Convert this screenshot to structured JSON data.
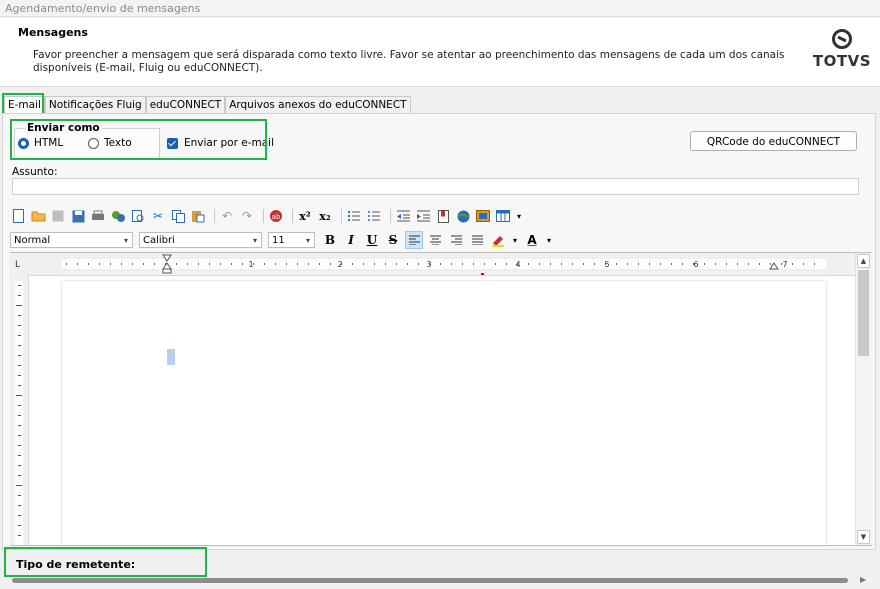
{
  "window": {
    "title": "Agendamento/envio de mensagens"
  },
  "header": {
    "title": "Mensagens",
    "description": "Favor preencher a mensagem que será disparada como texto livre. Favor se atentar ao preenchimento das mensagens de cada um dos canais disponíveis (E-mail, Fluig ou eduCONNECT).",
    "logo_text": "TOTVS"
  },
  "tabs": [
    {
      "label": "E-mail",
      "active": true
    },
    {
      "label": "Notificações Fluig"
    },
    {
      "label": "eduCONNECT"
    },
    {
      "label": "Arquivos anexos do eduCONNECT"
    }
  ],
  "email": {
    "send_as_label": "Enviar como",
    "format_html": "HTML",
    "format_text": "Texto",
    "selected_format": "HTML",
    "send_by_email_label": "Enviar por e-mail",
    "send_by_email_checked": true,
    "qrcode_button": "QRCode do eduCONNECT",
    "subject_label": "Assunto:",
    "subject_value": ""
  },
  "editor": {
    "style": "Normal",
    "font": "Calibri",
    "size": "11",
    "bold": "B",
    "italic": "I",
    "underline": "U",
    "strike": "S",
    "superscript": "x²",
    "subscript": "x₂",
    "font_color_letter": "A",
    "ruler_numbers": [
      "1",
      "2",
      "3",
      "4",
      "5",
      "6",
      "7"
    ]
  },
  "footer": {
    "sender_type_label": "Tipo de remetente:"
  },
  "colors": {
    "highlight": "#22b24c",
    "accent": "#1a5fb4"
  }
}
